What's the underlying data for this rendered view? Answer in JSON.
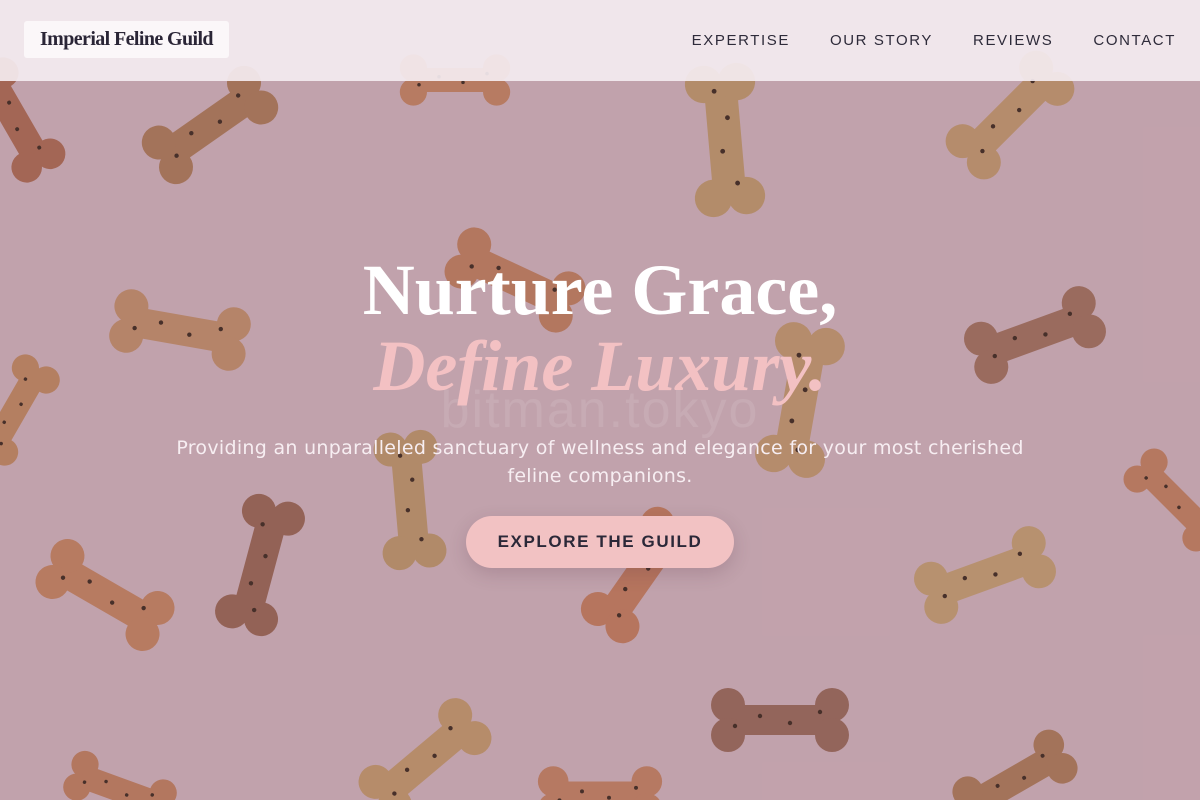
{
  "brand": {
    "name": "Imperial Feline Guild"
  },
  "nav": {
    "items": [
      "EXPERTISE",
      "OUR STORY",
      "REVIEWS",
      "CONTACT"
    ]
  },
  "hero": {
    "title_line1": "Nurture Grace,",
    "title_line2": "Define Luxury.",
    "subtitle": "Providing an unparalleled sanctuary of wellness and elegance for your most cherished feline companions.",
    "cta_label": "EXPLORE THE GUILD",
    "watermark": "bitman.tokyo"
  },
  "colors": {
    "background": "#d7b6be",
    "header_bg": "#f4ecf0",
    "accent_pink": "#f2c2c3",
    "title_white": "#ffffff",
    "text_dark": "#2b2838"
  },
  "background_image": {
    "subject": "bone-shaped-dog-biscuits-on-pink"
  }
}
